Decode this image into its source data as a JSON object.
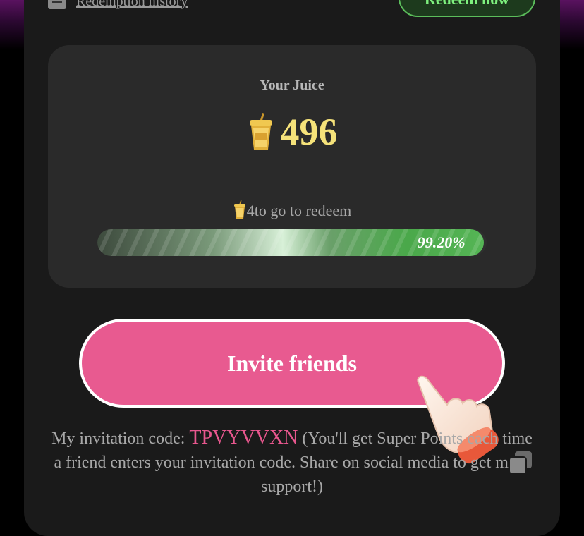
{
  "top_row": {
    "history_label": "Redemption history",
    "redeem_label": "Redeem now"
  },
  "juice": {
    "label": "Your Juice",
    "amount": "496",
    "to_go_text": "4to go to redeem",
    "progress_fraction": 0.992,
    "progress_label": "99.20%"
  },
  "invite": {
    "button_label": "Invite friends",
    "text_before_code": "My invitation code: ",
    "code": "TPVYVVXN",
    "text_after_code": " (You'll get Super Points each time a friend enters your invitation code. Share on social media to get more support!)"
  },
  "icons": {
    "history": "history-icon",
    "cup": "juice-cup-icon",
    "hand": "pointing-hand-icon",
    "copy": "copy-icon"
  },
  "colors": {
    "accent_pink": "#e85a90",
    "juice_yellow": "#f5e27a",
    "redeem_green": "#7ef07e",
    "progress_green": "#4aa84a"
  }
}
